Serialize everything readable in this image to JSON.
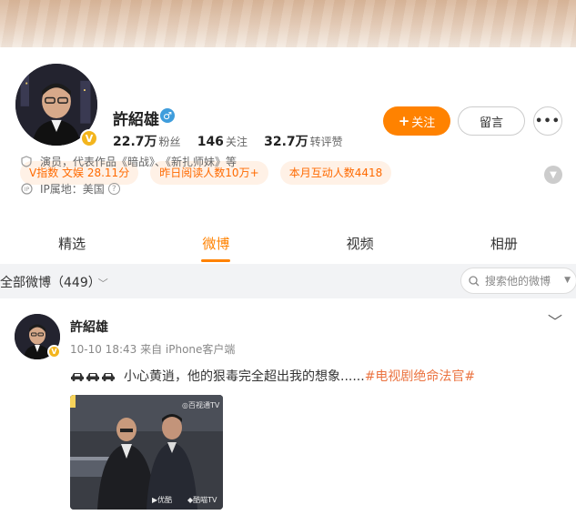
{
  "profile": {
    "name": "許紹雄",
    "verified_mark": "V",
    "gender_icon": "male-icon",
    "stats": [
      {
        "value": "22.7万",
        "label": "粉丝"
      },
      {
        "value": "146",
        "label": "关注"
      },
      {
        "value": "32.7万",
        "label": "转评赞"
      }
    ],
    "follow_label": "关注",
    "message_label": "留言",
    "more_label": "•••",
    "tags": [
      "V指数 文娱 28.11分",
      "昨日阅读人数10万+",
      "本月互动人数4418"
    ],
    "bio": "演员，代表作品《暗战》、《新扎师妹》等",
    "ip": "IP属地：美国"
  },
  "tabs": [
    {
      "label": "精选",
      "active": false
    },
    {
      "label": "微博",
      "active": true
    },
    {
      "label": "视频",
      "active": false
    },
    {
      "label": "相册",
      "active": false
    }
  ],
  "filter": {
    "label": "全部微博（449）",
    "search_placeholder": "搜索他的微博"
  },
  "post": {
    "author": "許紹雄",
    "meta": "10-10 18:43  来自 iPhone客户端",
    "emoji": "car-icon x3",
    "text": "小心黄逍，他的狠毒完全超出我的想象......",
    "hashtag": "#电视剧绝命法官#",
    "image_watermarks": {
      "top_right": "◎百视通TV",
      "bottom_left": "▶优酷",
      "bottom_right": "◆酷喵TV"
    }
  },
  "colors": {
    "accent": "#ff8200",
    "tag_bg": "#fff1e6",
    "tag_text": "#ff6a00",
    "hashtag": "#eb7340",
    "verified": "#f3b51d"
  }
}
